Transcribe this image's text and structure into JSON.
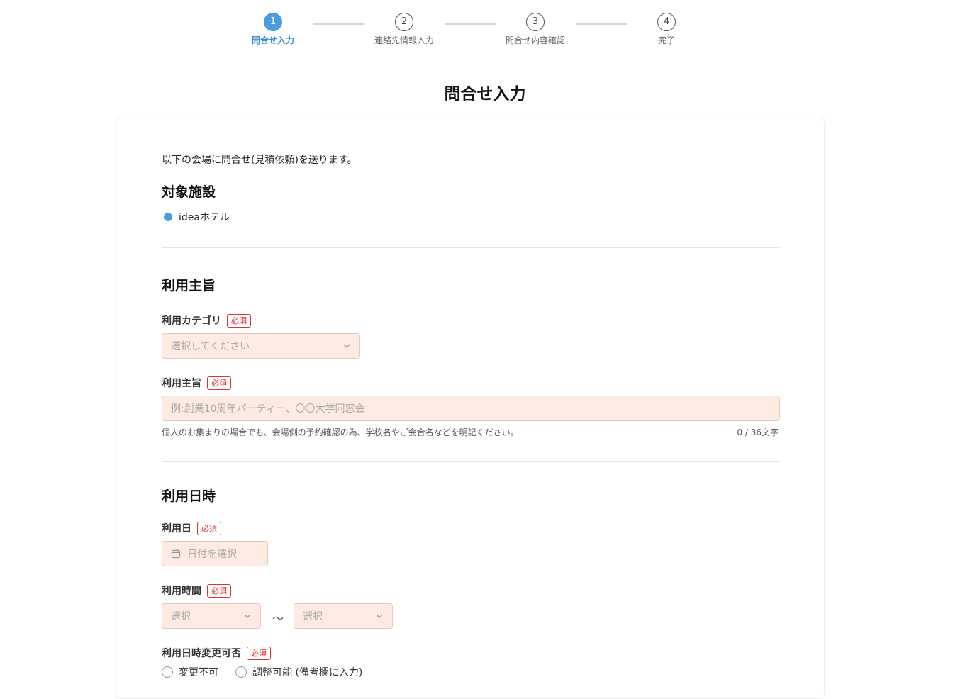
{
  "stepper": {
    "steps": [
      {
        "num": "1",
        "label": "問合せ入力"
      },
      {
        "num": "2",
        "label": "連絡先情報入力"
      },
      {
        "num": "3",
        "label": "問合せ内容確認"
      },
      {
        "num": "4",
        "label": "完了"
      }
    ],
    "active_step": 1,
    "active_color": "#4a9be0"
  },
  "page": {
    "title": "問合せ入力"
  },
  "intro": "以下の会場に問合せ(見積依頼)を送ります。",
  "facility_section": {
    "title": "対象施設",
    "facility_name": "ideaホテル"
  },
  "purpose_section": {
    "title": "利用主旨",
    "category": {
      "label": "利用カテゴリ",
      "required": "必須",
      "placeholder": "選択してください",
      "icon": "chevron-down-icon"
    },
    "purpose": {
      "label": "利用主旨",
      "required": "必須",
      "placeholder": "例:創業10周年パーティー、〇〇大学同窓会",
      "hint": "個人のお集まりの場合でも、会場側の予約確認の為、学校名やご会合名などを明記ください。",
      "counter": "0 / 36文字"
    }
  },
  "datetime_section": {
    "title": "利用日時",
    "date": {
      "label": "利用日",
      "required": "必須",
      "placeholder": "日付を選択",
      "icon": "calendar-icon"
    },
    "time": {
      "label": "利用時間",
      "required": "必須",
      "start_placeholder": "選択",
      "end_placeholder": "選択",
      "separator": "〜"
    },
    "changeable": {
      "label": "利用日時変更可否",
      "required": "必須",
      "options": [
        "変更不可",
        "調整可能 (備考欄に入力)"
      ]
    }
  },
  "colors": {
    "required": "#dd3333",
    "field_bg": "#fdeae2",
    "field_border": "#e6c8bc"
  }
}
